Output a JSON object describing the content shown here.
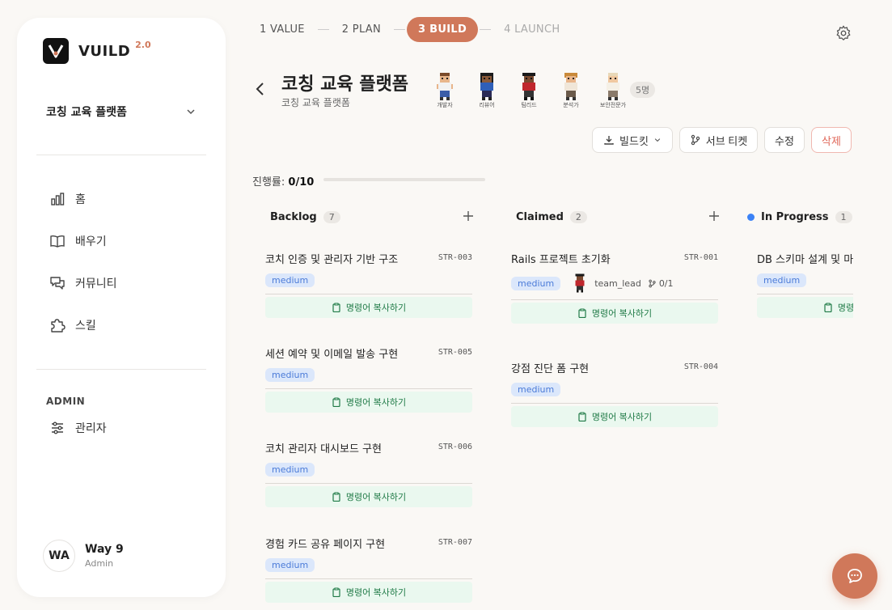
{
  "app": {
    "name": "VUILD",
    "version": "2.0"
  },
  "sidebar": {
    "project": "코칭 교육 플랫폼",
    "nav": [
      {
        "label": "홈",
        "icon": "chart-icon"
      },
      {
        "label": "배우기",
        "icon": "book-icon"
      },
      {
        "label": "커뮤니티",
        "icon": "chat-icon"
      },
      {
        "label": "스킬",
        "icon": "puzzle-icon"
      }
    ],
    "admin_label": "ADMIN",
    "admin_item": "관리자",
    "user": {
      "initials": "WA",
      "name": "Way 9",
      "role": "Admin"
    }
  },
  "steps": [
    {
      "label": "1  VALUE",
      "state": "done"
    },
    {
      "label": "2  PLAN",
      "state": "done"
    },
    {
      "label": "3  BUILD",
      "state": "active"
    },
    {
      "label": "4  LAUNCH",
      "state": "pending"
    }
  ],
  "project": {
    "title": "코칭 교육 플랫폼",
    "subtitle": "코칭 교육 플랫폼",
    "team": [
      {
        "label": "개발자"
      },
      {
        "label": "리뷰어"
      },
      {
        "label": "팀리드"
      },
      {
        "label": "분석가"
      },
      {
        "label": "보안전문가"
      }
    ],
    "team_count": "5명"
  },
  "actions": {
    "buildkit": "빌드킷",
    "subticket": "서브 티켓",
    "edit": "수정",
    "delete": "삭제"
  },
  "progress": {
    "label": "진행률:",
    "value": "0/10",
    "fraction": 0
  },
  "columns": [
    {
      "title": "Backlog",
      "count": "7",
      "cards": [
        {
          "title": "코치 인증 및 관리자 기반 구조",
          "id": "STR-003",
          "priority": "medium",
          "copy": "명령어 복사하기"
        },
        {
          "title": "세션 예약 및 이메일 발송 구현",
          "id": "STR-005",
          "priority": "medium",
          "copy": "명령어 복사하기"
        },
        {
          "title": "코치 관리자 대시보드 구현",
          "id": "STR-006",
          "priority": "medium",
          "copy": "명령어 복사하기"
        },
        {
          "title": "경험 카드 공유 페이지 구현",
          "id": "STR-007",
          "priority": "medium",
          "copy": "명령어 복사하기"
        }
      ]
    },
    {
      "title": "Claimed",
      "count": "2",
      "cards": [
        {
          "title": "Rails 프로젝트 초기화",
          "id": "STR-001",
          "priority": "medium",
          "assignee": "team_lead",
          "subtasks": "0/1",
          "copy": "명령어 복사하기"
        },
        {
          "title": "강점 진단 폼 구현",
          "id": "STR-004",
          "priority": "medium",
          "copy": "명령어 복사하기"
        }
      ]
    },
    {
      "title": "In Progress",
      "count": "1",
      "status_color": "#3b82f6",
      "cards": [
        {
          "title": "DB 스키마 설계 및 마이그레이션",
          "id": "",
          "priority": "medium",
          "copy": "명령어 복사하기"
        }
      ]
    }
  ],
  "colors": {
    "accent": "#d0785a",
    "badge_bg": "#dbe7fb",
    "badge_text": "#4b7bd8",
    "copy_bg": "#eaf8ef",
    "copy_text": "#1f7a46"
  }
}
